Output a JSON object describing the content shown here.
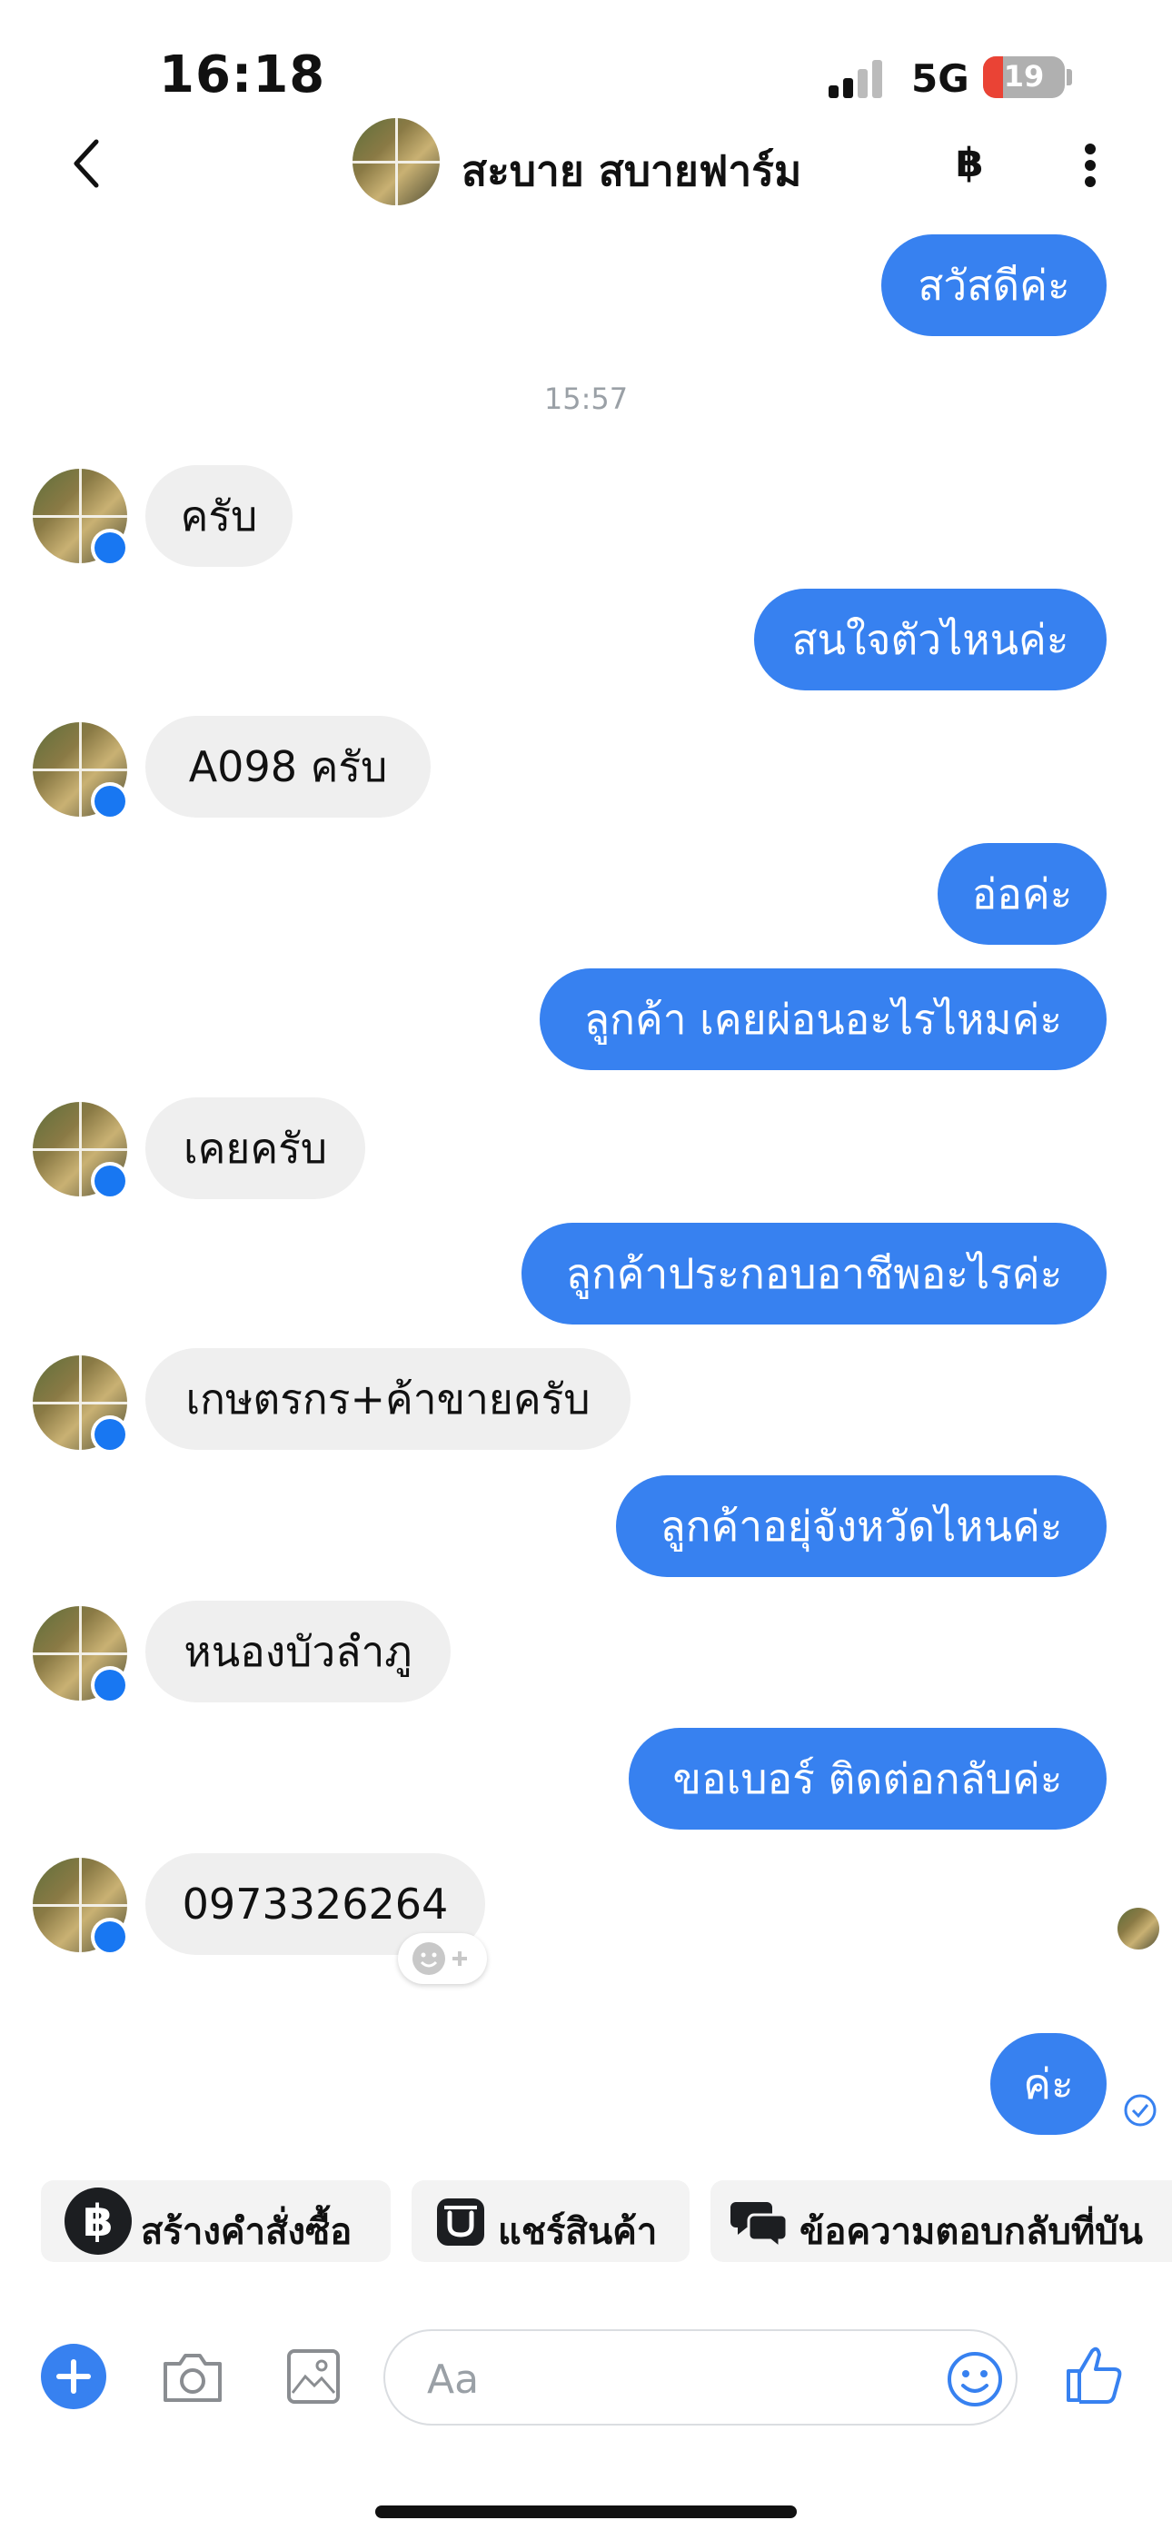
{
  "status_bar": {
    "time": "16:18",
    "network": "5G",
    "battery": "19"
  },
  "header": {
    "contact_name": "สะบาย สบายฟาร์ม",
    "currency_icon": "฿"
  },
  "chat": {
    "timestamp": "15:57",
    "messages": [
      {
        "from": "me",
        "text": "สวัสดีค่ะ"
      },
      {
        "from": "them",
        "text": "ครับ"
      },
      {
        "from": "me",
        "text": "สนใจตัวไหนค่ะ"
      },
      {
        "from": "them",
        "text": "A098  ครับ"
      },
      {
        "from": "me",
        "text": "อ่อค่ะ"
      },
      {
        "from": "me",
        "text": "ลูกค้า เคยผ่อนอะไรไหมค่ะ"
      },
      {
        "from": "them",
        "text": "เคยครับ"
      },
      {
        "from": "me",
        "text": "ลูกค้าประกอบอาชีพอะไรค่ะ"
      },
      {
        "from": "them",
        "text": "เกษตรกร+ค้าขายครับ"
      },
      {
        "from": "me",
        "text": "ลูกค้าอยุ่จังหวัดไหนค่ะ"
      },
      {
        "from": "them",
        "text": "หนองบัวลำภู"
      },
      {
        "from": "me",
        "text": "ขอเบอร์ ติดต่อกลับค่ะ"
      },
      {
        "from": "them",
        "text": "0973326264"
      },
      {
        "from": "me",
        "text": "ค่ะ"
      }
    ]
  },
  "quick_replies": [
    {
      "label": "สร้างคำสั่งซื้อ",
      "icon": "baht-icon"
    },
    {
      "label": "แชร์สินค้า",
      "icon": "shop-icon"
    },
    {
      "label": "ข้อความตอบกลับที่บัน",
      "icon": "saved-replies-icon"
    }
  ],
  "composer": {
    "placeholder": "Aa"
  },
  "colors": {
    "accent": "#3781f0",
    "incoming_bubble": "#efefef"
  }
}
